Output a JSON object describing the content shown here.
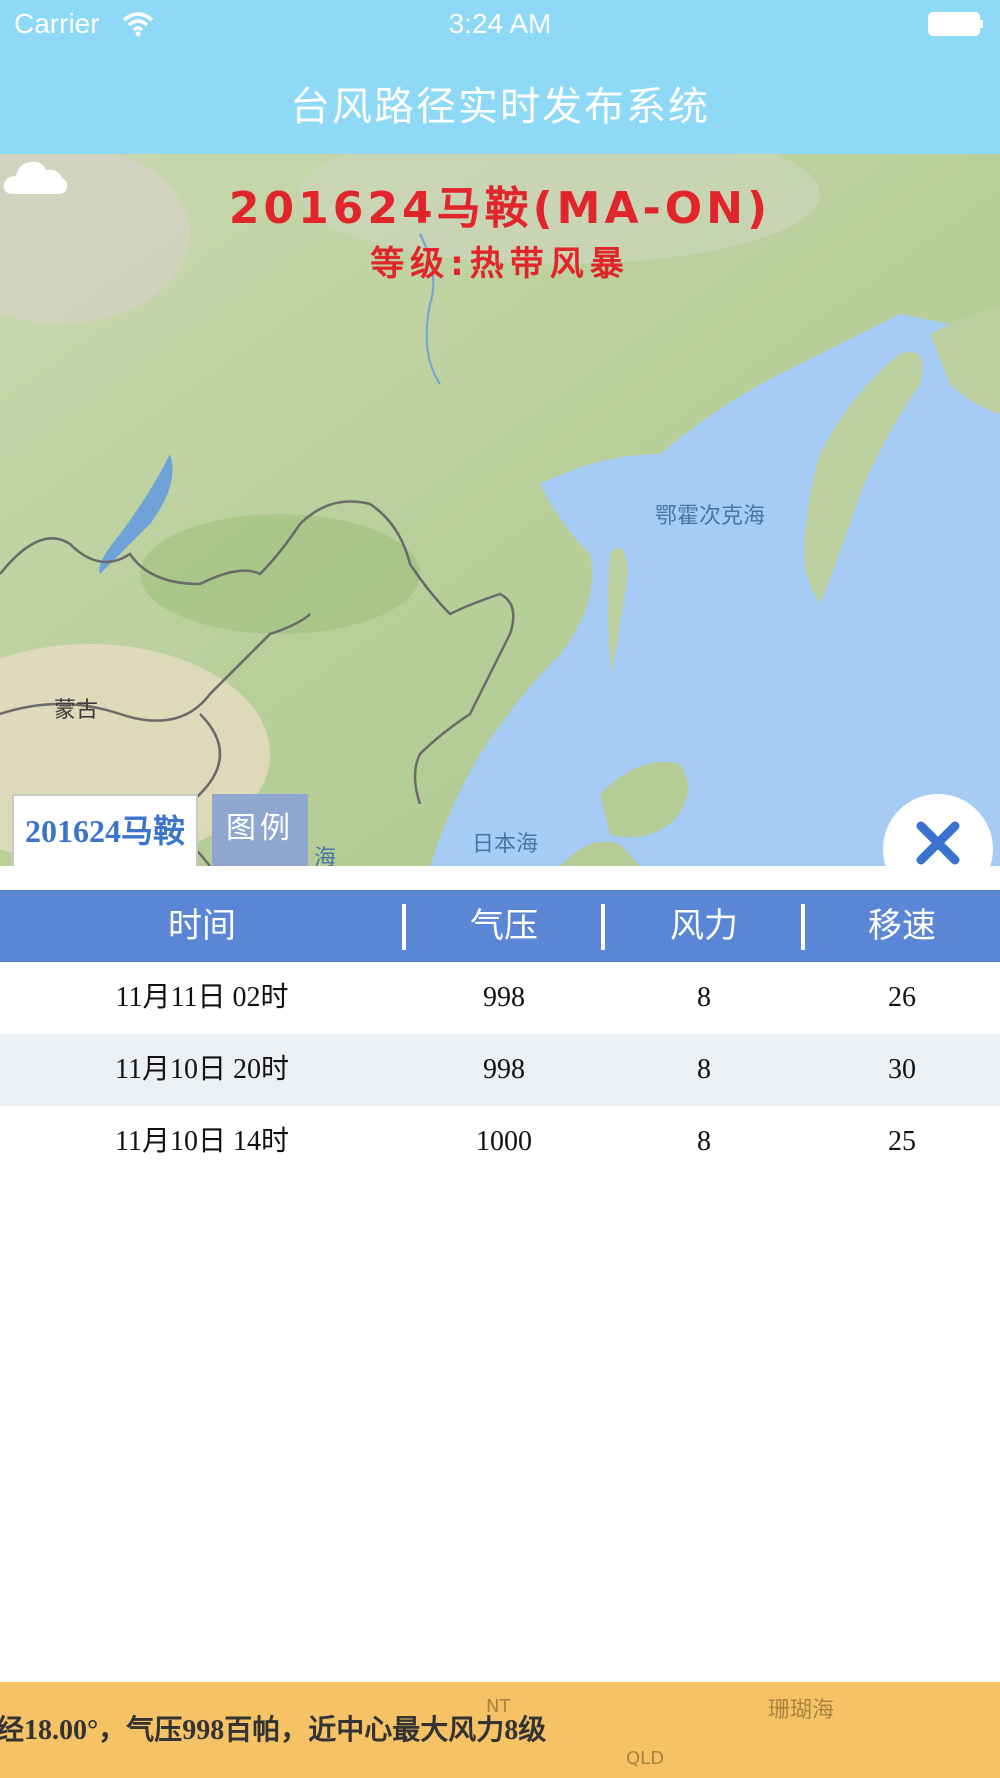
{
  "status_bar": {
    "carrier": "Carrier",
    "time": "3:24 AM"
  },
  "header": {
    "title": "台风路径实时发布系统"
  },
  "map": {
    "storm_title": "201624马鞍(MA-ON)",
    "storm_level": "等级:热带风暴",
    "labels": {
      "okhotsk_sea": "鄂霍次克海",
      "mongolia": "蒙古",
      "japan_sea": "日本海",
      "sea_partial": "海"
    },
    "tabs": {
      "storm": "201624马鞍",
      "legend": "图例"
    }
  },
  "table": {
    "headers": [
      "时间",
      "气压",
      "风力",
      "移速"
    ],
    "rows": [
      [
        "11月11日 02时",
        "998",
        "8",
        "26"
      ],
      [
        "11月10日 20时",
        "998",
        "8",
        "30"
      ],
      [
        "11月10日 14时",
        "1000",
        "8",
        "25"
      ]
    ]
  },
  "ticker": {
    "text": "经18.00°，气压998百帕，近中心最大风力8级",
    "map_labels": {
      "nt": "NT",
      "qld": "QLD",
      "coral_sea": "珊瑚海"
    }
  },
  "colors": {
    "header_bg": "#8dd9f6",
    "table_header_bg": "#5b86d6",
    "storm_red": "#e0262a",
    "ticker_bg": "#f6c266"
  },
  "icons": [
    "wifi-icon",
    "battery-icon",
    "cloud-icon",
    "close-icon"
  ]
}
